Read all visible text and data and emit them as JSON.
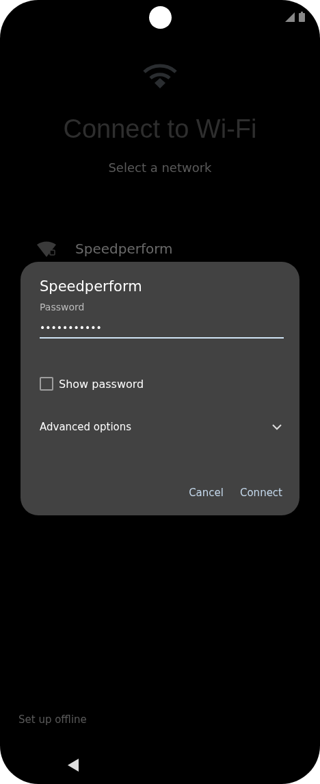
{
  "setup": {
    "title": "Connect to Wi-Fi",
    "subtitle": "Select a network",
    "networks": [
      {
        "name": "Speedperform",
        "locked": true
      }
    ],
    "offline_link": "Set up offline"
  },
  "dialog": {
    "title": "Speedperform",
    "password_label": "Password",
    "password_value": "•••••••••••",
    "show_password": {
      "label": "Show password",
      "checked": false
    },
    "advanced": {
      "label": "Advanced options",
      "expanded": false
    },
    "buttons": [
      "Cancel",
      "Connect"
    ]
  }
}
